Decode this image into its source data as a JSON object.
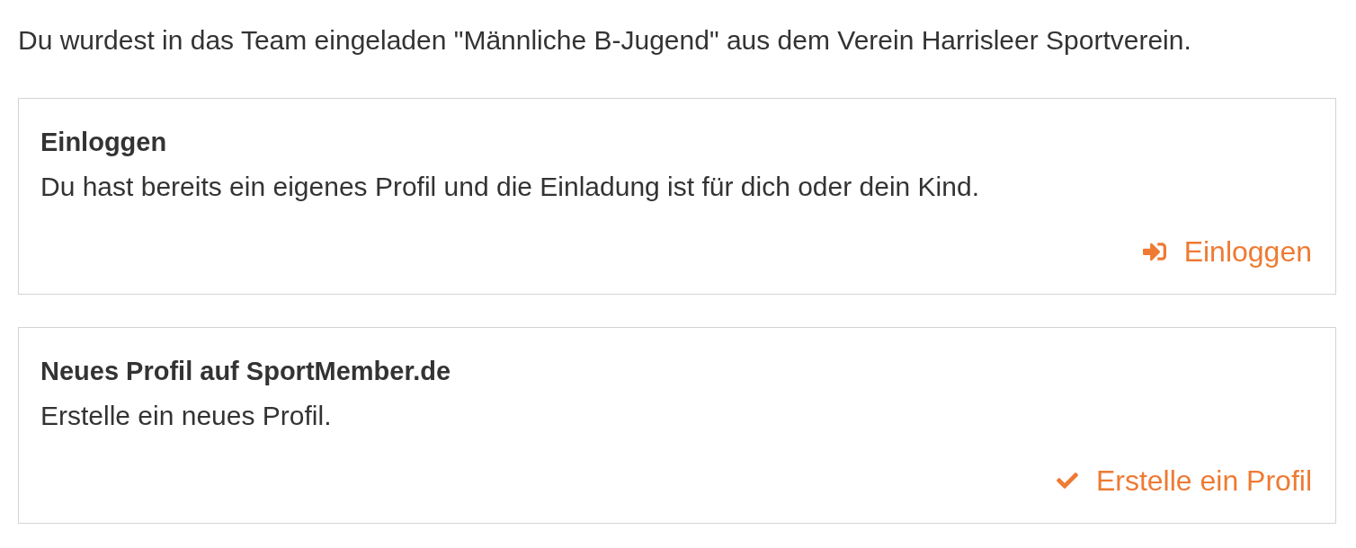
{
  "intro": "Du wurdest in das Team eingeladen \"Männliche B-Jugend\" aus dem Verein Harrisleer Sportverein.",
  "cards": [
    {
      "title": "Einloggen",
      "description": "Du hast bereits ein eigenes Profil und die Einladung ist für dich oder dein Kind.",
      "action": {
        "kind": "login",
        "label": "Einloggen"
      }
    },
    {
      "title": "Neues Profil auf SportMember.de",
      "description": "Erstelle ein neues Profil.",
      "action": {
        "kind": "check",
        "label": "Erstelle ein Profil"
      }
    }
  ]
}
